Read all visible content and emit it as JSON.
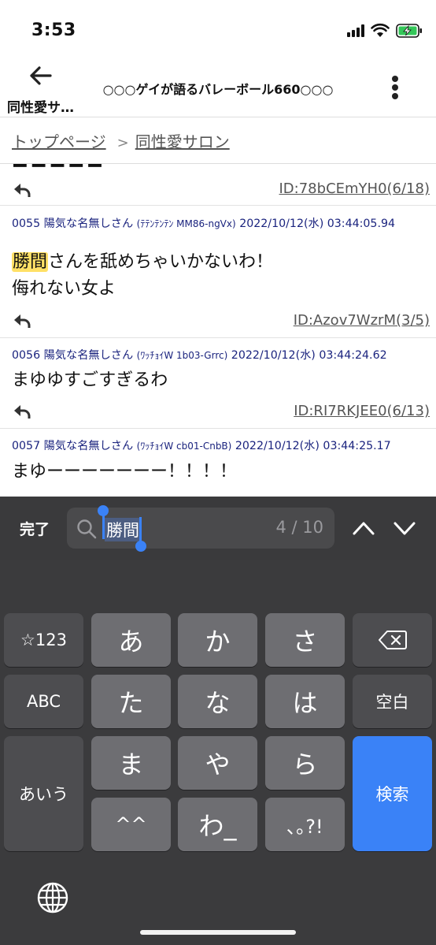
{
  "status": {
    "time": "3:53"
  },
  "header": {
    "back_label": "同性愛サ…",
    "title": "○○○ゲイが語るバレーボール660○○○"
  },
  "breadcrumb": {
    "top": "トップページ",
    "separator": ">",
    "board": "同性愛サロン"
  },
  "posts": [
    {
      "id_text": "ID:78bCEmYH0(6/18)"
    },
    {
      "number": "0055",
      "name": "陽気な名無しさん",
      "trip": "(ﾃﾃﾝﾃﾝﾃﾝ MM86-ngVx)",
      "datetime": "2022/10/12(水) 03:44:05.94",
      "highlight": "勝間",
      "line1_rest": "さんを舐めちゃいかないわ！",
      "line2": "侮れない女よ",
      "id_text": "ID:Azov7WzrM(3/5)"
    },
    {
      "number": "0056",
      "name": "陽気な名無しさん",
      "trip": "(ﾜｯﾁｮｲW 1b03-Grrc)",
      "datetime": "2022/10/12(水) 03:44:24.62",
      "line1": "まゆゆすごすぎるわ",
      "id_text": "ID:RI7RKJEE0(6/13)"
    },
    {
      "number": "0057",
      "name": "陽気な名無しさん",
      "trip": "(ﾜｯﾁｮｲW cb01-CnbB)",
      "datetime": "2022/10/12(水) 03:44:25.17",
      "line1": "まゆーーーーーーー！！！！"
    }
  ],
  "find_bar": {
    "done_label": "完了",
    "query": "勝間",
    "count": "4 / 10"
  },
  "keyboard": {
    "row1": {
      "mode": "☆123",
      "k1": "あ",
      "k2": "か",
      "k3": "さ"
    },
    "row2": {
      "mode": "ABC",
      "k1": "た",
      "k2": "な",
      "k3": "は",
      "space": "空白"
    },
    "row3": {
      "mode": "あいう",
      "k1": "ま",
      "k2": "や",
      "k3": "ら",
      "enter": "検索"
    },
    "row4": {
      "k1": "^^",
      "k2": "わ_",
      "k3": "､｡?!"
    }
  },
  "colors": {
    "accent": "#3a82f7",
    "highlight": "#ffe066",
    "post_header": "#1a237e"
  }
}
